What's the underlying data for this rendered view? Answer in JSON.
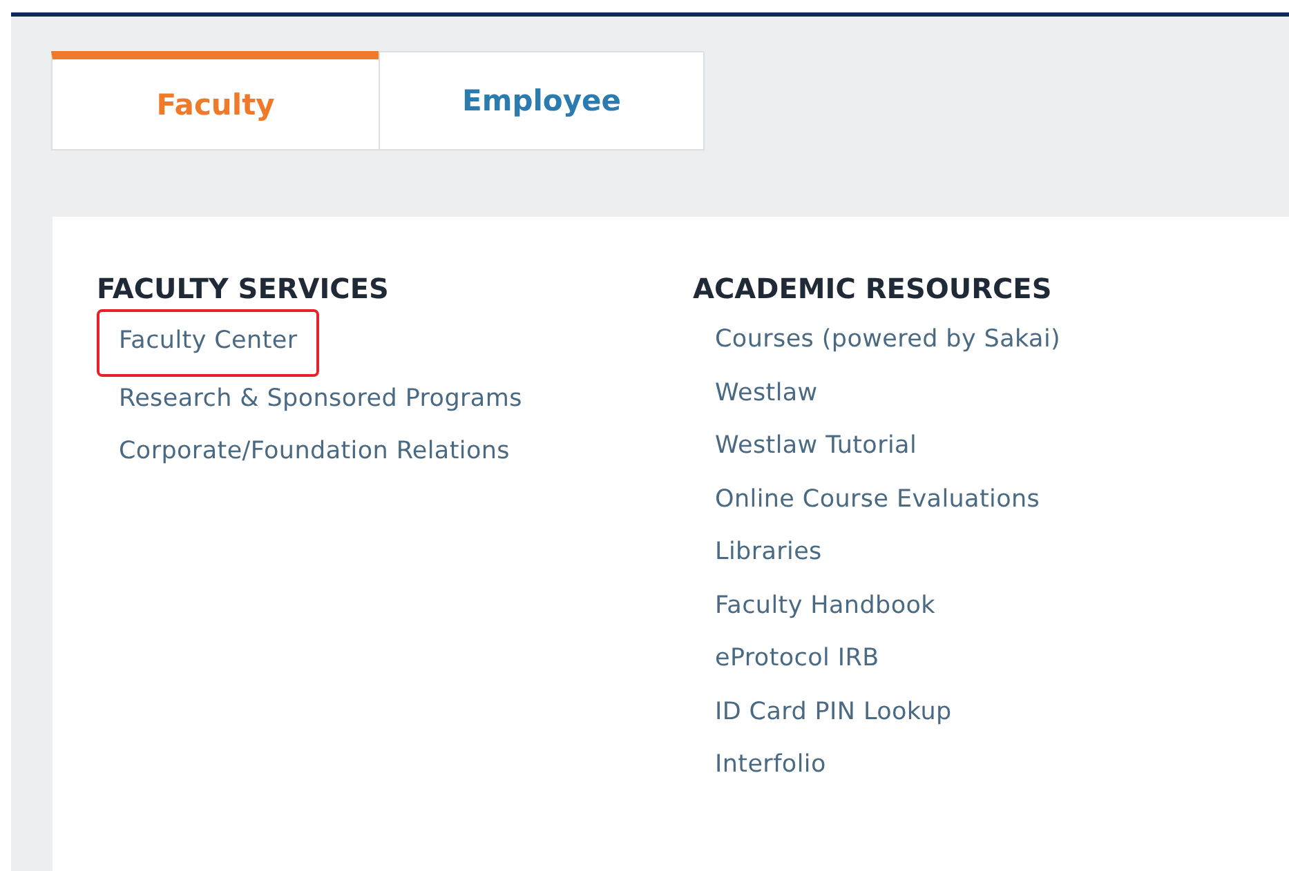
{
  "tabs": [
    {
      "label": "Faculty",
      "selected": true
    },
    {
      "label": "Employee",
      "selected": false
    }
  ],
  "sections": [
    {
      "title": "FACULTY SERVICES",
      "links": [
        {
          "label": "Faculty Center",
          "highlighted": true
        },
        {
          "label": "Research & Sponsored Programs",
          "highlighted": false
        },
        {
          "label": "Corporate/Foundation Relations",
          "highlighted": false
        }
      ]
    },
    {
      "title": "ACADEMIC RESOURCES",
      "links": [
        {
          "label": "Courses (powered by Sakai)",
          "highlighted": false
        },
        {
          "label": "Westlaw",
          "highlighted": false
        },
        {
          "label": "Westlaw Tutorial",
          "highlighted": false
        },
        {
          "label": "Online Course Evaluations",
          "highlighted": false
        },
        {
          "label": "Libraries",
          "highlighted": false
        },
        {
          "label": "Faculty Handbook",
          "highlighted": false
        },
        {
          "label": "eProtocol IRB",
          "highlighted": false
        },
        {
          "label": "ID Card PIN Lookup",
          "highlighted": false
        },
        {
          "label": "Interfolio",
          "highlighted": false
        }
      ]
    }
  ]
}
